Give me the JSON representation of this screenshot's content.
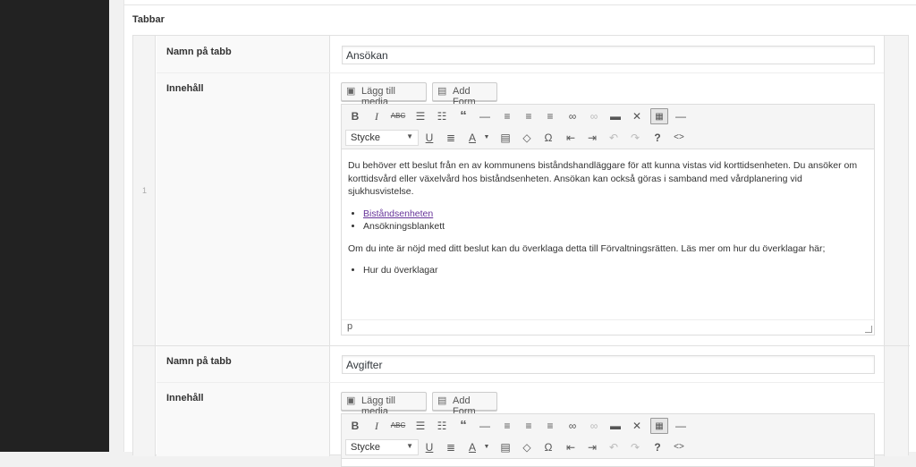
{
  "field_label": "Tabbar",
  "rows": [
    {
      "index": "1",
      "name_label": "Namn på tabb",
      "name_value": "Ansökan",
      "content_label": "Innehåll"
    },
    {
      "name_label": "Namn på tabb",
      "name_value": "Avgifter",
      "content_label": "Innehåll"
    }
  ],
  "media": {
    "add_media": "Lägg till media",
    "add_form": "Add Form"
  },
  "toolbar": {
    "format_select": "Stycke"
  },
  "editor1": {
    "para1": "Du behöver ett beslut från en av kommunens biståndshandläggare för att kunna vistas vid korttidsenheten. Du ansöker om korttidsvård eller växelvård hos biståndsenheten. Ansökan kan också göras i samband med vårdplanering vid sjukhusvistelse.",
    "list1": [
      "Biståndsenheten",
      "Ansökningsblankett"
    ],
    "para2": "Om du inte är nöjd med ditt beslut kan du överklaga detta till Förvaltningsrätten. Läs mer om hur du överklagar här;",
    "list2": [
      "Hur du överklagar"
    ],
    "status_path": "p"
  }
}
